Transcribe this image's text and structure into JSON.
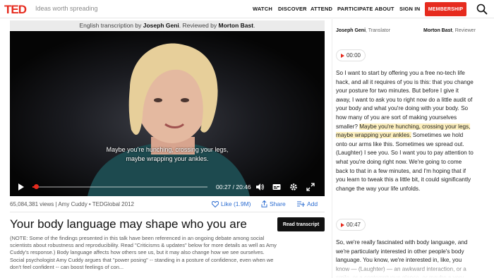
{
  "header": {
    "logo": "TED",
    "tagline": "Ideas worth spreading",
    "nav": [
      "WATCH",
      "DISCOVER",
      "ATTEND",
      "PARTICIPATE",
      "ABOUT",
      "SIGN IN"
    ],
    "membership": "MEMBERSHIP"
  },
  "banner": {
    "prefix": "English transcription by ",
    "transcriber": "Joseph Geni",
    "middle": ". Reviewed by ",
    "reviewer": "Morton Bast",
    "suffix": "."
  },
  "video": {
    "caption_line1": "Maybe you're hunching, crossing your legs,",
    "caption_line2": "maybe wrapping your ankles.",
    "time": "00:27 / 20:46",
    "progress": 0.022
  },
  "meta": {
    "views": "65,084,381 views | Amy Cuddy • TEDGlobal 2012",
    "like": "Like (1.9M)",
    "share": "Share",
    "add": "Add"
  },
  "talk": {
    "title": "Your body language may shape who you are",
    "read_transcript": "Read transcript",
    "description": "(NOTE: Some of the findings presented in this talk have been referenced in an ongoing debate among social scientists about robustness and reproducibility. Read \"Criticisms & updates\" below for more details as well as Amy Cuddy's response.) Body language affects how others see us, but it may also change how we see ourselves. Social psychologist Amy Cuddy argues that \"power posing\" -- standing in a posture of confidence, even when we don't feel confident -- can boost feelings of con..."
  },
  "transcript": {
    "translator_name": "Joseph Geni",
    "translator_role": ", Translator",
    "reviewer_name": "Morton Bast",
    "reviewer_role": ", Reviewer",
    "blocks": [
      {
        "time": "00:00",
        "text_before": "So I want to start by offering you a free no-tech life hack, and all it requires of you is this: that you change your posture for two minutes. But before I give it away, I want to ask you to right now do a little audit of your body and what you're doing with your body. So how many of you are sort of making yourselves smaller? ",
        "highlight": "Maybe you're hunching, crossing your legs, maybe wrapping your ankles.",
        "text_after": " Sometimes we hold onto our arms like this. Sometimes we spread out. (Laughter) I see you. So I want you to pay attention to what you're doing right now. We're going to come back to that in a few minutes, and I'm hoping that if you learn to tweak this a little bit, it could significantly change the way your life unfolds."
      },
      {
        "time": "00:47",
        "text": "So, we're really fascinated with body language, and we're particularly interested in other people's body language. You know, we're interested in, like, you know — (Laughter) — an awkward interaction, or a smile, or a contemptuous glance, or maybe a very"
      }
    ]
  }
}
